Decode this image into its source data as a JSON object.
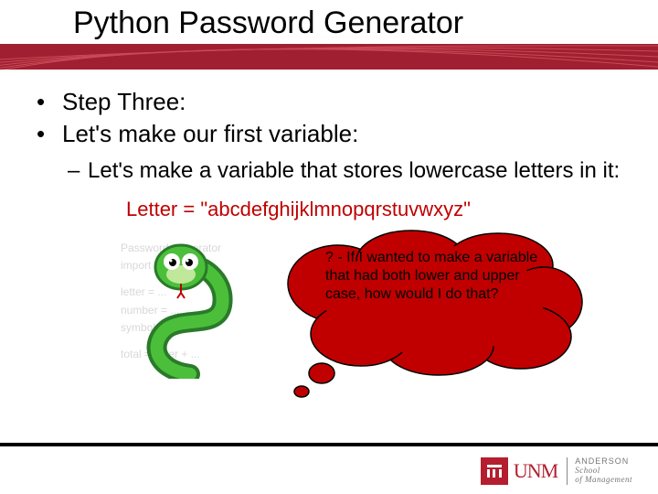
{
  "title": "Python Password Generator",
  "bullets": {
    "b1": "Step Three:",
    "b2": "Let's make our first variable:"
  },
  "sub": "Let's make a variable that stores lowercase letters in it:",
  "code": "Letter = \"abcdefghijklmnopqrstuvwxyz\"",
  "thought": "? - If I wanted to make a variable that had both lower and upper case, how would I do that?",
  "bgcode": {
    "l1": "Password Generator",
    "l2": "import random",
    "l3": "letter = ...",
    "l4": "number = ...",
    "l5": "symbol = ...",
    "l6": "total = letter + ..."
  },
  "logo": {
    "unm": "UNM",
    "school1": "ANDERSON",
    "school2": "School",
    "school3": "of Management"
  }
}
